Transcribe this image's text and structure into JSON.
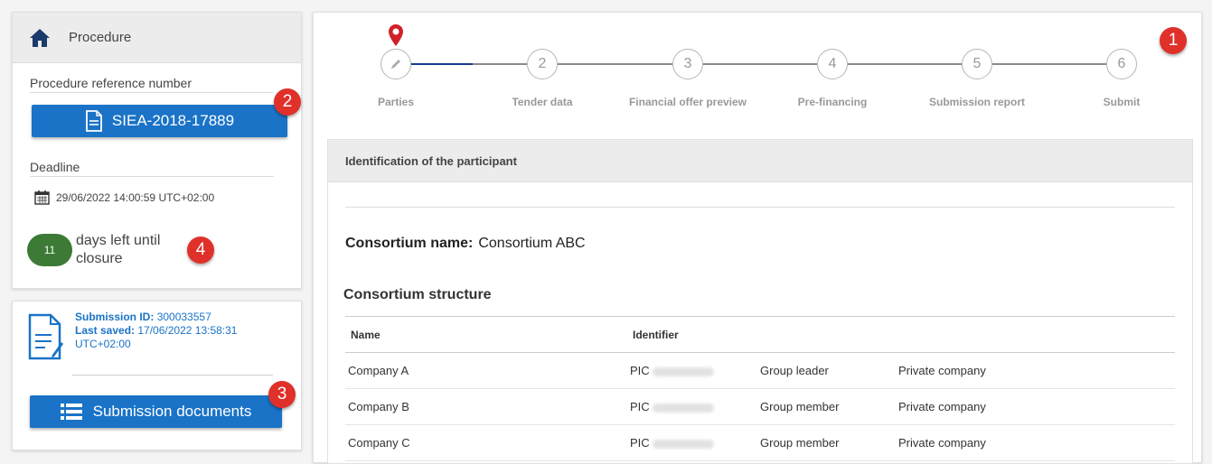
{
  "procedure": {
    "title": "Procedure",
    "ref_label": "Procedure reference number",
    "ref_number": "SIEA-2018-17889",
    "deadline_label": "Deadline",
    "deadline": "29/06/2022 14:00:59 UTC+02:00",
    "days_left": "11",
    "days_left_text": "days left until closure"
  },
  "submission": {
    "id_label": "Submission ID:",
    "id_value": "300033557",
    "saved_label": "Last saved:",
    "saved_value": "17/06/2022 13:58:31 UTC+02:00",
    "docs_button": "Submission documents"
  },
  "badges": [
    "1",
    "2",
    "3",
    "4"
  ],
  "steps": [
    {
      "num": "1",
      "label": "Parties"
    },
    {
      "num": "2",
      "label": "Tender data"
    },
    {
      "num": "3",
      "label": "Financial offer preview"
    },
    {
      "num": "4",
      "label": "Pre-financing"
    },
    {
      "num": "5",
      "label": "Submission report"
    },
    {
      "num": "6",
      "label": "Submit"
    }
  ],
  "participant": {
    "header": "Identification of the participant",
    "consortium_label": "Consortium name:",
    "consortium_name": "Consortium ABC",
    "structure_title": "Consortium structure",
    "columns": [
      "Name",
      "Identifier"
    ],
    "rows": [
      {
        "name": "Company A",
        "id_prefix": "PIC",
        "role": "Group leader",
        "type": "Private company"
      },
      {
        "name": "Company B",
        "id_prefix": "PIC",
        "role": "Group member",
        "type": "Private company"
      },
      {
        "name": "Company C",
        "id_prefix": "PIC",
        "role": "Group member",
        "type": "Private company"
      }
    ]
  },
  "colors": {
    "accent": "#1a73c7",
    "badge": "#e0302a",
    "pill": "#3c7a35",
    "marker": "#d0202a"
  }
}
